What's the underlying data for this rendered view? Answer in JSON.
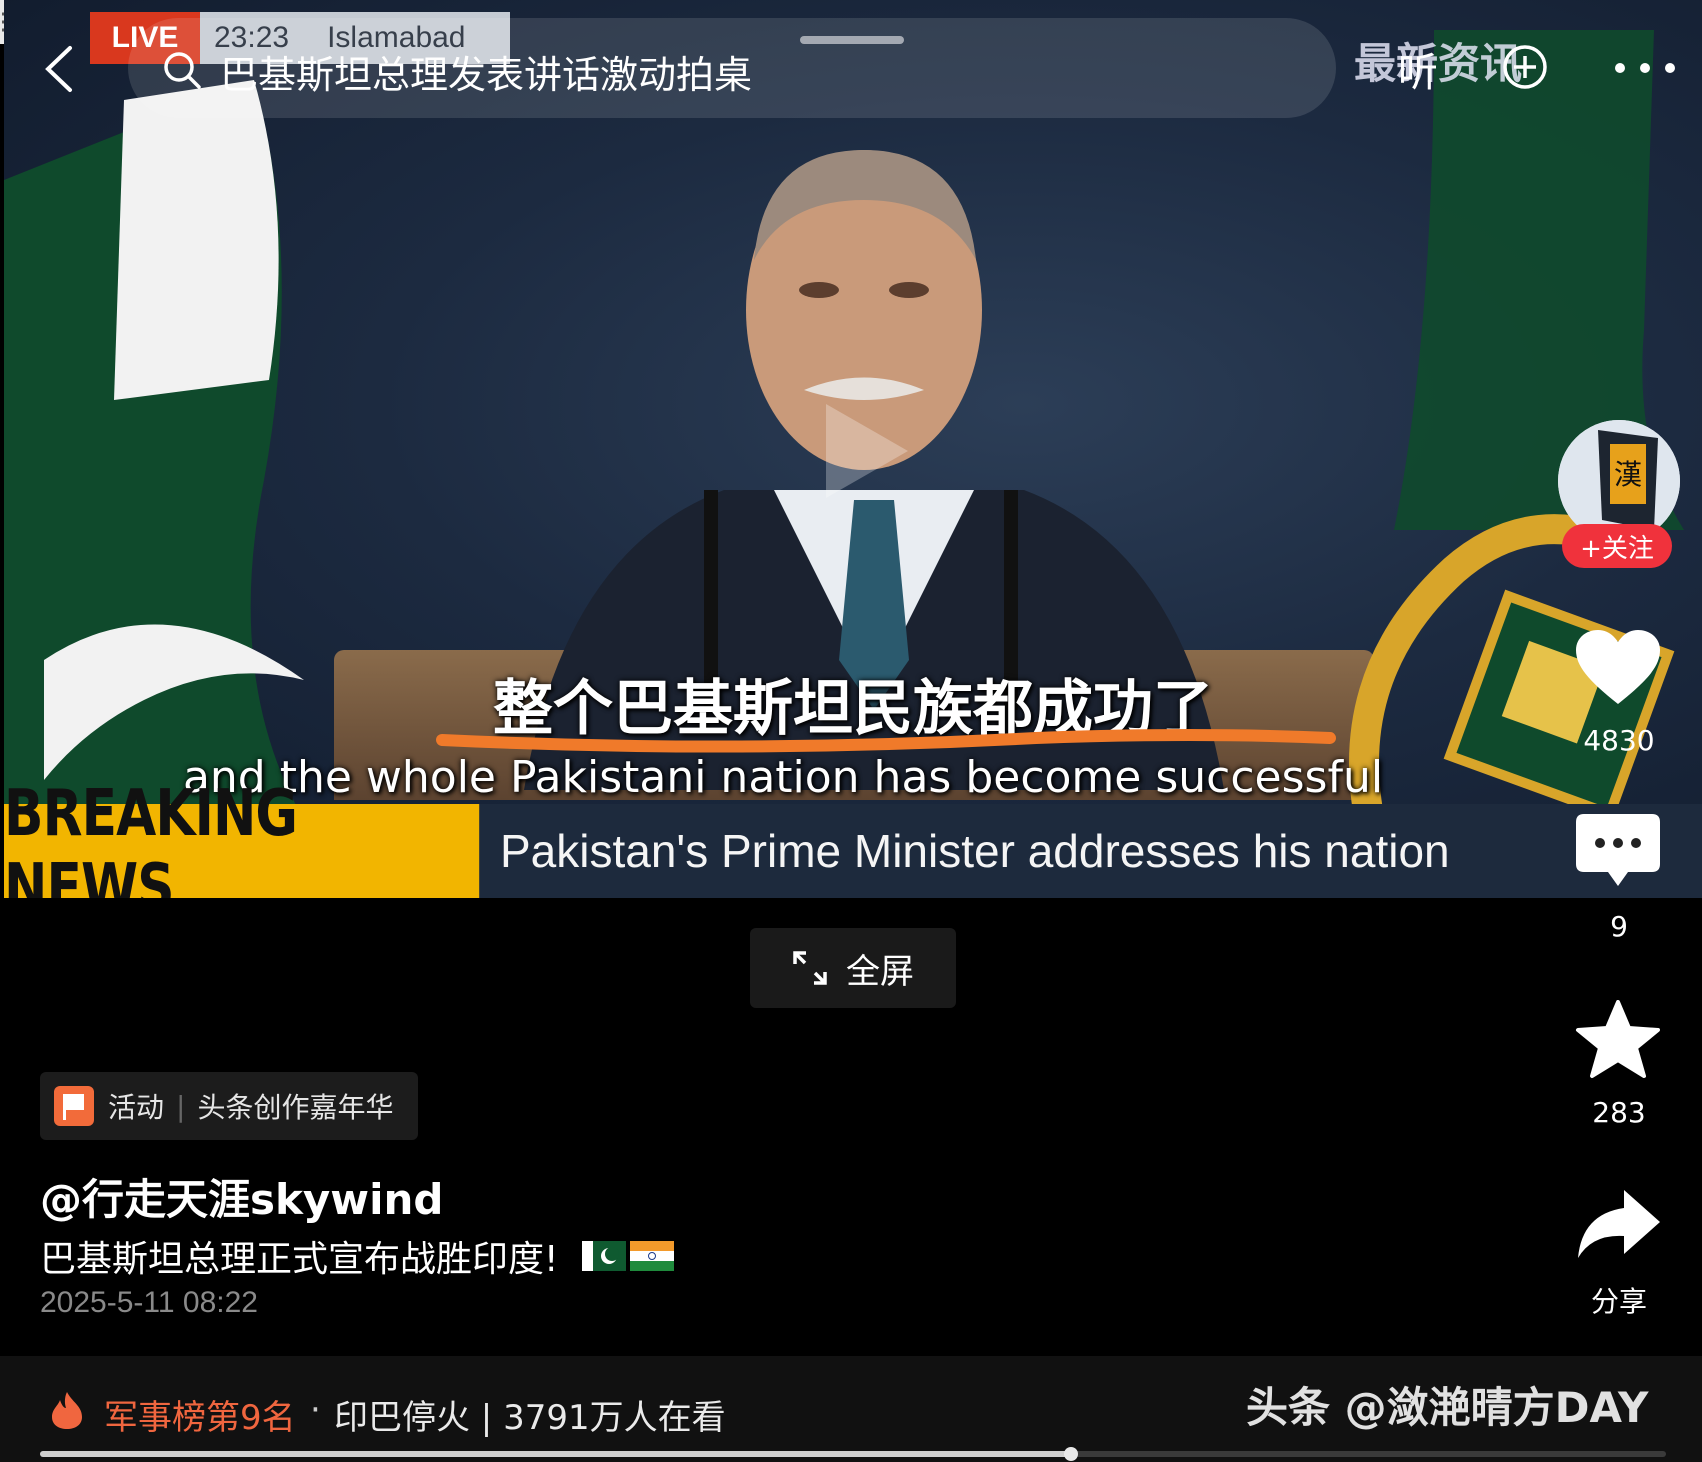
{
  "video": {
    "live_tag": "LIVE",
    "live_time": "23:23",
    "live_location": "Islamabad",
    "channel_logo": "最新资讯",
    "subtitle_cn": "整个巴基斯坦民族都成功了",
    "subtitle_en": "and the whole Pakistani nation has become successful",
    "breaking_label": "BREAKING NEWS",
    "breaking_text": "Pakistan's Prime Minister addresses his nation",
    "accent_underline_color": "#f07a2a"
  },
  "top_bar": {
    "search_text": "巴基斯坦总理发表讲话激动拍桌",
    "listen_label": "听",
    "icons": [
      "back-icon",
      "search-icon",
      "add-icon",
      "more-icon"
    ]
  },
  "rail": {
    "avatar_text": "漢",
    "follow_label": "+关注",
    "like_count": "4830",
    "comment_count": "9",
    "favorite_count": "283",
    "share_label": "分享"
  },
  "fullscreen": {
    "label": "全屏"
  },
  "info": {
    "activity_label": "活动",
    "activity_name": "头条创作嘉年华",
    "author": "@行走天涯skywind",
    "description": "巴基斯坦总理正式宣布战胜印度!",
    "date": "2025-5-11 08:22"
  },
  "bottom": {
    "rank_text": "军事榜第9名",
    "separator": "·",
    "topic_text": "印巴停火 | 3791万人在看",
    "watermark": "头条 @潋滟晴方DAY",
    "progress_fraction": 0.634
  },
  "colors": {
    "accent_red": "#f0323c",
    "rank_orange": "#f0663f",
    "breaking_yellow": "#f2b500"
  }
}
